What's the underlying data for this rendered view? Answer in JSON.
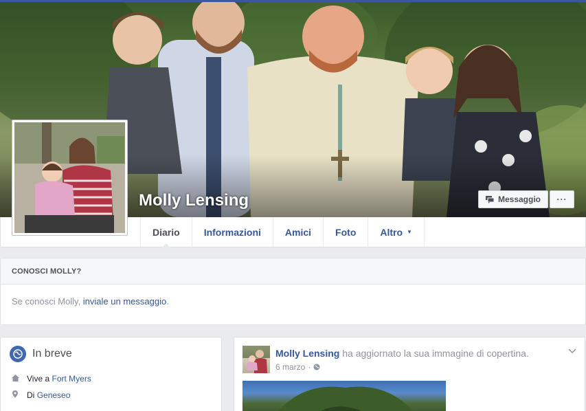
{
  "profile": {
    "name": "Molly Lensing",
    "message_button": "Messaggio",
    "more_button": "···"
  },
  "nav": {
    "tabs": [
      {
        "label": "Diario",
        "active": true
      },
      {
        "label": "Informazioni",
        "active": false
      },
      {
        "label": "Amici",
        "active": false
      },
      {
        "label": "Foto",
        "active": false
      },
      {
        "label": "Altro",
        "active": false
      }
    ]
  },
  "know_box": {
    "title": "CONOSCI MOLLY?",
    "text_prefix": "Se conosci Molly, ",
    "link": "inviale un messaggio",
    "text_suffix": "."
  },
  "intro": {
    "title": "In breve",
    "rows": [
      {
        "icon": "house-icon",
        "prefix": "Vive a ",
        "link": "Fort Myers"
      },
      {
        "icon": "location-pin-icon",
        "prefix": "Di ",
        "link": "Geneseo"
      }
    ]
  },
  "post": {
    "author": "Molly Lensing",
    "action": " ha aggiornato la sua immagine di copertina.",
    "date": "6 marzo",
    "privacy_icon": "globe-icon"
  },
  "colors": {
    "brand_blue": "#3b5998",
    "link_blue": "#365899",
    "page_bg": "#e9ebee"
  }
}
